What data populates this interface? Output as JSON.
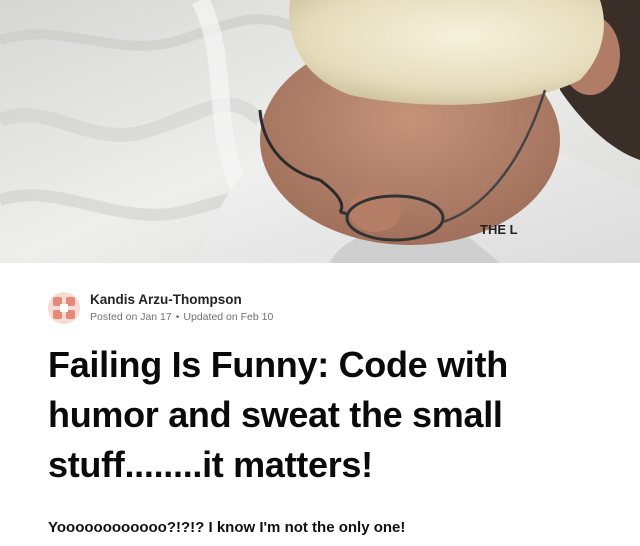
{
  "cover": {
    "icon": "cover-photo",
    "shirt_print": "THE L"
  },
  "author": {
    "name": "Kandis Arzu-Thompson",
    "avatar_icon": "user-avatar-icon",
    "posted_on": "Posted on Jan 17",
    "separator": "•",
    "updated_on": "Updated on Feb 10"
  },
  "article": {
    "title": "Failing Is Funny: Code with humor and sweat the small stuff........it matters!",
    "lead": "Yoooooooooooo?!?!? I know I'm not the only one!"
  },
  "colors": {
    "text": "#0a0a0a",
    "meta": "#717171",
    "avatar_accent": "#e07a6b"
  }
}
